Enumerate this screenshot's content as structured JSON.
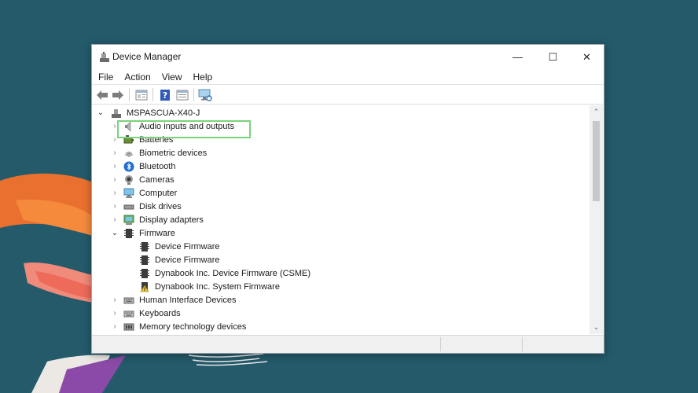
{
  "window": {
    "title": "Device Manager"
  },
  "controls": {
    "minimize": "—",
    "maximize": "☐",
    "close": "✕"
  },
  "menu": [
    "File",
    "Action",
    "View",
    "Help"
  ],
  "toolbar": [
    "back-icon",
    "forward-icon",
    "properties-icon",
    "help-icon",
    "update-driver-icon",
    "scan-hardware-icon"
  ],
  "tree": {
    "root": "MSPASCUA-X40-J",
    "categories": [
      {
        "label": "Audio inputs and outputs",
        "icon": "speaker-icon",
        "expanded": false,
        "highlighted": true
      },
      {
        "label": "Batteries",
        "icon": "battery-icon",
        "expanded": false
      },
      {
        "label": "Biometric devices",
        "icon": "fingerprint-icon",
        "expanded": false
      },
      {
        "label": "Bluetooth",
        "icon": "bluetooth-icon",
        "expanded": false
      },
      {
        "label": "Cameras",
        "icon": "camera-icon",
        "expanded": false
      },
      {
        "label": "Computer",
        "icon": "monitor-icon",
        "expanded": false
      },
      {
        "label": "Disk drives",
        "icon": "disk-drive-icon",
        "expanded": false
      },
      {
        "label": "Display adapters",
        "icon": "display-adapter-icon",
        "expanded": false
      },
      {
        "label": "Firmware",
        "icon": "firmware-icon",
        "expanded": true,
        "children": [
          {
            "label": "Device Firmware",
            "icon": "firmware-icon"
          },
          {
            "label": "Device Firmware",
            "icon": "firmware-icon"
          },
          {
            "label": "Dynabook Inc. Device Firmware (CSME)",
            "icon": "firmware-icon"
          },
          {
            "label": "Dynabook Inc. System Firmware",
            "icon": "firmware-warning-icon"
          }
        ]
      },
      {
        "label": "Human Interface Devices",
        "icon": "hid-icon",
        "expanded": false
      },
      {
        "label": "Keyboards",
        "icon": "keyboard-icon",
        "expanded": false
      },
      {
        "label": "Memory technology devices",
        "icon": "memory-icon",
        "expanded": false
      }
    ]
  },
  "colors": {
    "desktop": "#245a6a",
    "highlight": "#79d47a",
    "accent": "#1f6fd0"
  }
}
